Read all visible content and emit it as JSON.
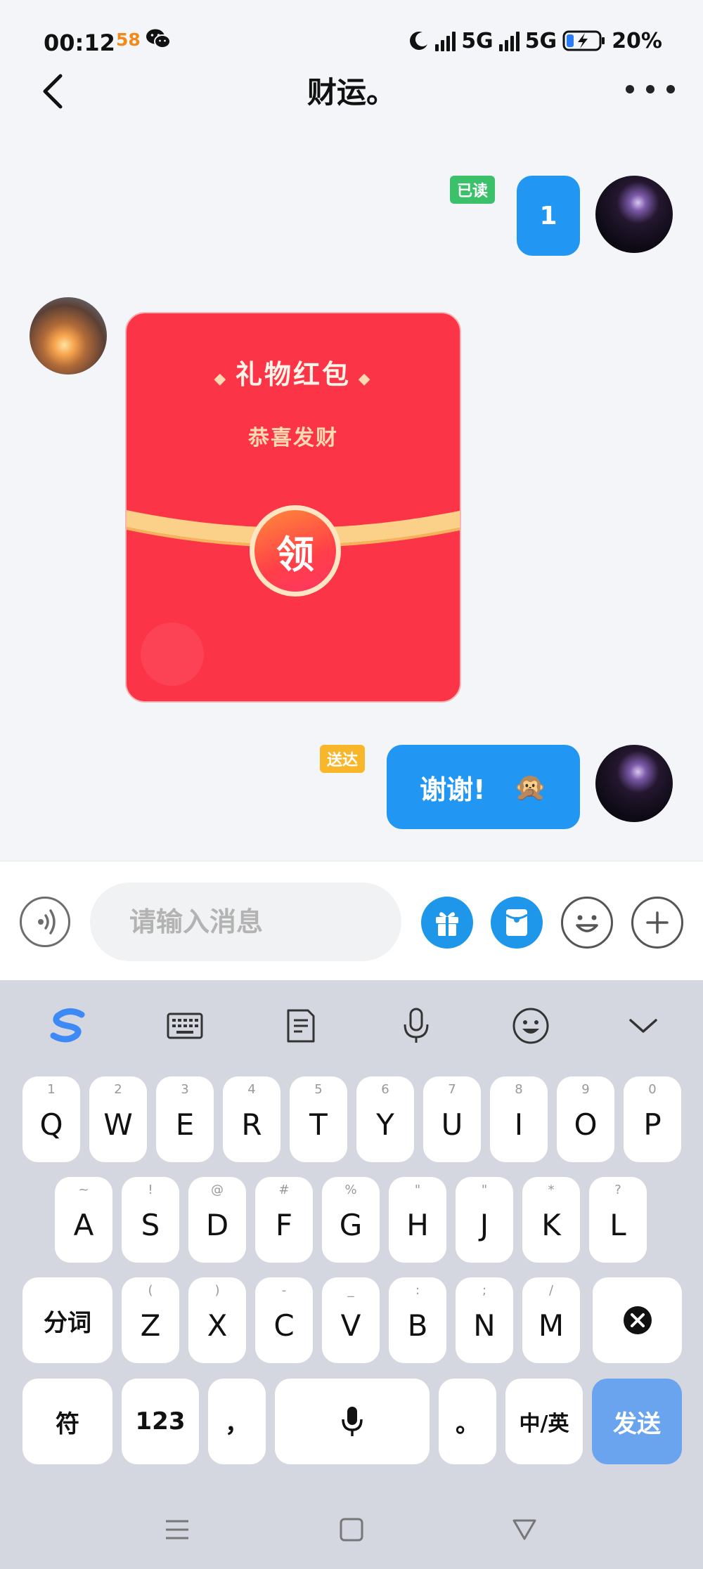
{
  "status_bar": {
    "time": "00:12",
    "app_badge": "58",
    "network_1": "5G",
    "network_2": "5G",
    "battery": "20%"
  },
  "header": {
    "title": "财运。"
  },
  "messages": [
    {
      "badge": "已读",
      "text": "1"
    },
    {
      "red_packet": {
        "title": "礼物红包",
        "subtitle": "恭喜发财",
        "claim": "领"
      }
    },
    {
      "badge": "送达",
      "text": "谢谢!",
      "emoji": "🙊"
    }
  ],
  "input": {
    "placeholder": "请输入消息"
  },
  "keyboard": {
    "row1": [
      {
        "hint": "1",
        "key": "Q"
      },
      {
        "hint": "2",
        "key": "W"
      },
      {
        "hint": "3",
        "key": "E"
      },
      {
        "hint": "4",
        "key": "R"
      },
      {
        "hint": "5",
        "key": "T"
      },
      {
        "hint": "6",
        "key": "Y"
      },
      {
        "hint": "7",
        "key": "U"
      },
      {
        "hint": "8",
        "key": "I"
      },
      {
        "hint": "9",
        "key": "O"
      },
      {
        "hint": "0",
        "key": "P"
      }
    ],
    "row2": [
      {
        "hint": "~",
        "key": "A"
      },
      {
        "hint": "!",
        "key": "S"
      },
      {
        "hint": "@",
        "key": "D"
      },
      {
        "hint": "#",
        "key": "F"
      },
      {
        "hint": "%",
        "key": "G"
      },
      {
        "hint": "\"",
        "key": "H"
      },
      {
        "hint": "\"",
        "key": "J"
      },
      {
        "hint": "*",
        "key": "K"
      },
      {
        "hint": "?",
        "key": "L"
      }
    ],
    "row3": [
      {
        "hint": "(",
        "key": "Z"
      },
      {
        "hint": ")",
        "key": "X"
      },
      {
        "hint": "-",
        "key": "C"
      },
      {
        "hint": "_",
        "key": "V"
      },
      {
        "hint": ":",
        "key": "B"
      },
      {
        "hint": ";",
        "key": "N"
      },
      {
        "hint": "/",
        "key": "M"
      }
    ],
    "split_word": "分词",
    "symbols": "符",
    "numbers": "123",
    "comma": "，",
    "period": "。",
    "lang": "中/英",
    "send": "发送"
  }
}
